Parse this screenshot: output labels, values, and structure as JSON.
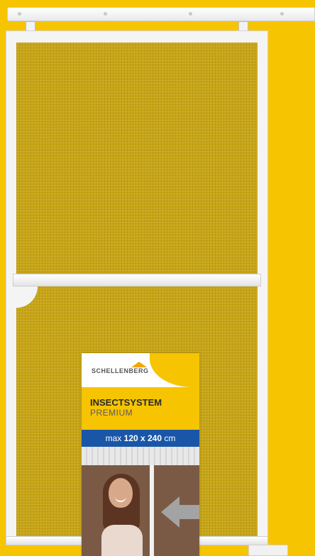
{
  "product_box": {
    "brand": "SCHELLENBERG",
    "title": "INSECTSYSTEM",
    "subtitle": "PREMIUM",
    "size_prefix": "max",
    "size_value": "120 x 240",
    "size_unit": "cm"
  },
  "colors": {
    "background": "#f6c400",
    "mesh": "#c8a514",
    "frame": "#f4f4f4",
    "band": "#1a56a8"
  }
}
